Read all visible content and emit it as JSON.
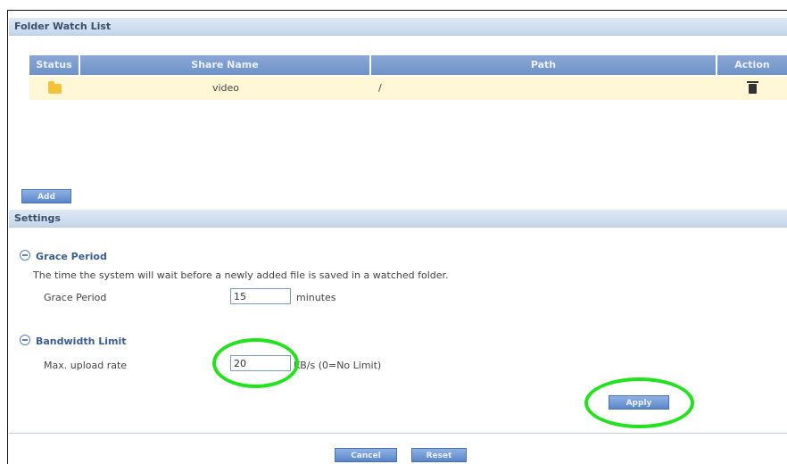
{
  "folder_watch": {
    "title": "Folder Watch List",
    "columns": [
      "Status",
      "Share Name",
      "Path",
      "Action"
    ],
    "rows": [
      {
        "status": "folder-icon",
        "share_name": "video",
        "path": "/",
        "action": "trash-icon"
      }
    ],
    "add_label": "Add"
  },
  "settings": {
    "title": "Settings",
    "grace": {
      "heading": "Grace Period",
      "description": "The time the system will wait before a newly added file is saved in a watched folder.",
      "label": "Grace Period",
      "value": "15",
      "unit": "minutes"
    },
    "bandwidth": {
      "heading": "Bandwidth Limit",
      "label": "Max. upload rate",
      "value": "20",
      "unit": "KB/s (0=No Limit)"
    },
    "apply_label": "Apply"
  },
  "footer": {
    "cancel_label": "Cancel",
    "reset_label": "Reset"
  },
  "colors": {
    "highlight_ring": "#22e11d",
    "header_blue": "#6f92c7",
    "row_highlight": "#fff7d6"
  }
}
